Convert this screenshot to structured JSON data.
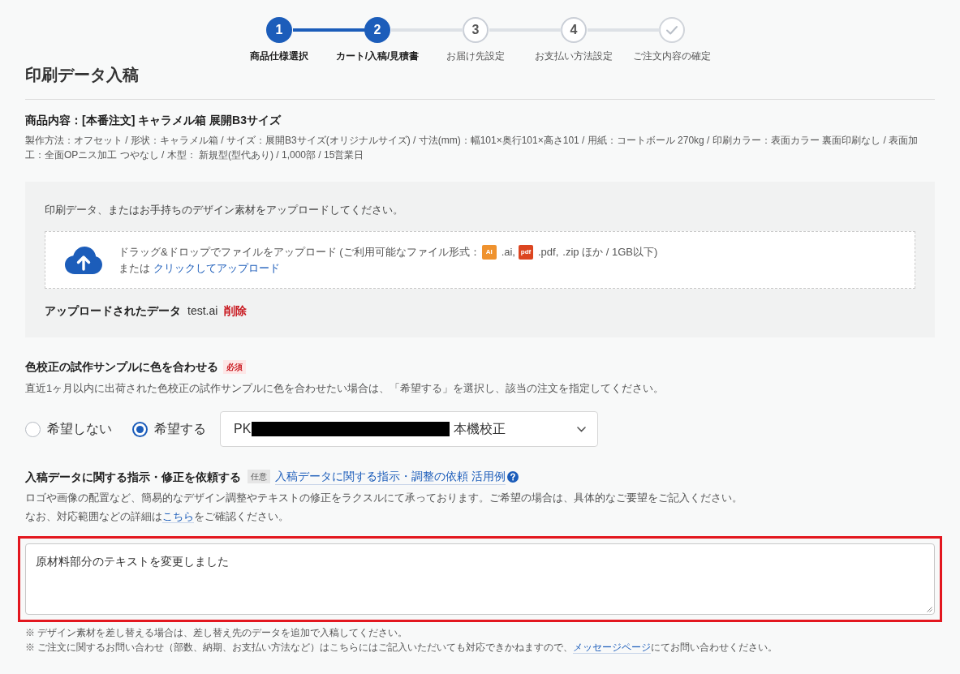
{
  "steps": [
    {
      "kind": "number",
      "number": "1",
      "label": "商品仕様選択",
      "active": true
    },
    {
      "kind": "number",
      "number": "2",
      "label": "カート/入稿/見積書",
      "active": true
    },
    {
      "kind": "number",
      "number": "3",
      "label": "お届け先設定",
      "active": false
    },
    {
      "kind": "number",
      "number": "4",
      "label": "お支払い方法設定",
      "active": false
    },
    {
      "kind": "check",
      "label": "ご注文内容の確定",
      "active": false
    }
  ],
  "page_title": "印刷データ入稿",
  "product": {
    "title": "商品内容：[本番注文] キャラメル箱 展開B3サイズ",
    "details": "製作方法：オフセット / 形状：キャラメル箱 / サイズ：展開B3サイズ(オリジナルサイズ) / 寸法(mm)：幅101×奥行101×高さ101 / 用紙：コートボール 270kg / 印刷カラー：表面カラー 裏面印刷なし / 表面加工：全面OPニス加工 つやなし / 木型： 新規型(型代あり) / 1,000部 / 15営業日"
  },
  "upload": {
    "instruction": "印刷データ、またはお手持ちのデザイン素材をアップロードしてください。",
    "drop_text": "ドラッグ&ドロップでファイルをアップロード (ご利用可能なファイル形式：",
    "file_types": [
      {
        "badge": "AI",
        "color": "#ef922e",
        "extension": ".ai,"
      },
      {
        "badge": "pdf",
        "color": "#dc4520",
        "extension": ".pdf,"
      }
    ],
    "drop_text_end": ".zip ほか / 1GB以下)",
    "or_text": "または",
    "click_link": "クリックしてアップロード",
    "uploaded_label": "アップロードされたデータ",
    "uploaded_file": "test.ai",
    "delete_link": "削除"
  },
  "color_match": {
    "title": "色校正の試作サンプルに色を合わせる",
    "badge": "必須",
    "description": "直近1ヶ月以内に出荷された色校正の試作サンプルに色を合わせたい場合は、「希望する」を選択し、該当の注文を指定してください。",
    "options": [
      {
        "label": "希望しない",
        "selected": false
      },
      {
        "label": "希望する",
        "selected": true
      }
    ],
    "select": {
      "value_start": "PK",
      "redacted": true,
      "value_end": "本機校正"
    }
  },
  "instructions": {
    "title": "入稿データに関する指示・修正を依頼する",
    "badge": "任意",
    "help_link": "入稿データに関する指示・調整の依頼 活用例",
    "description": "ロゴや画像の配置など、簡易的なデザイン調整やテキストの修正をラクスルにて承っております。ご希望の場合は、具体的なご要望をご記入ください。",
    "note": {
      "before": "なお、対応範囲などの詳細は",
      "link": "こちら",
      "after": "をご確認ください。"
    },
    "textarea": {
      "value": "原材料部分のテキストを変更しました",
      "highlighted": true
    }
  },
  "footnotes": [
    {
      "before": "※ デザイン素材を差し替える場合は、差し替え先のデータを追加で入稿してください。"
    },
    {
      "before": "※ ご注文に関するお問い合わせ（部数、納期、お支払い方法など）はこちらにはご記入いただいても対応できかねますので、",
      "link": "メッセージページ",
      "after": "にてお問い合わせください。"
    }
  ]
}
